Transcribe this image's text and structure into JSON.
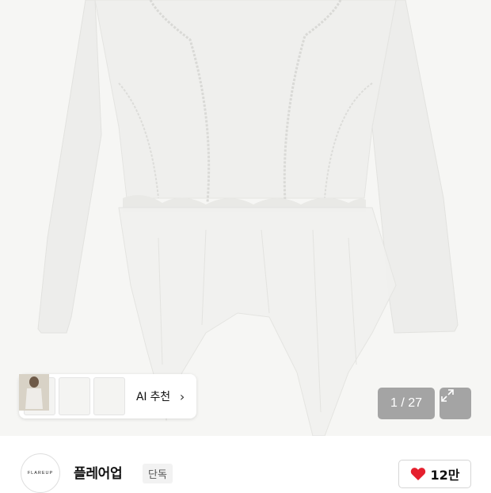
{
  "gallery": {
    "current_page": "1",
    "total_pages": "27",
    "counter_text": "1 / 27",
    "ai_recommend_label": "AI 추천",
    "thumbnails": [
      "thumbnail-flat-top",
      "thumbnail-flat-top-2",
      "thumbnail-model"
    ]
  },
  "brand": {
    "logo_text": "FLAREUP",
    "name": "플레어업",
    "badge": "단독"
  },
  "like": {
    "count": "12만",
    "heart_color": "#e5202e"
  },
  "icons": {
    "expand": "expand-icon",
    "chevron": "chevron-right-icon",
    "heart": "heart-icon"
  }
}
